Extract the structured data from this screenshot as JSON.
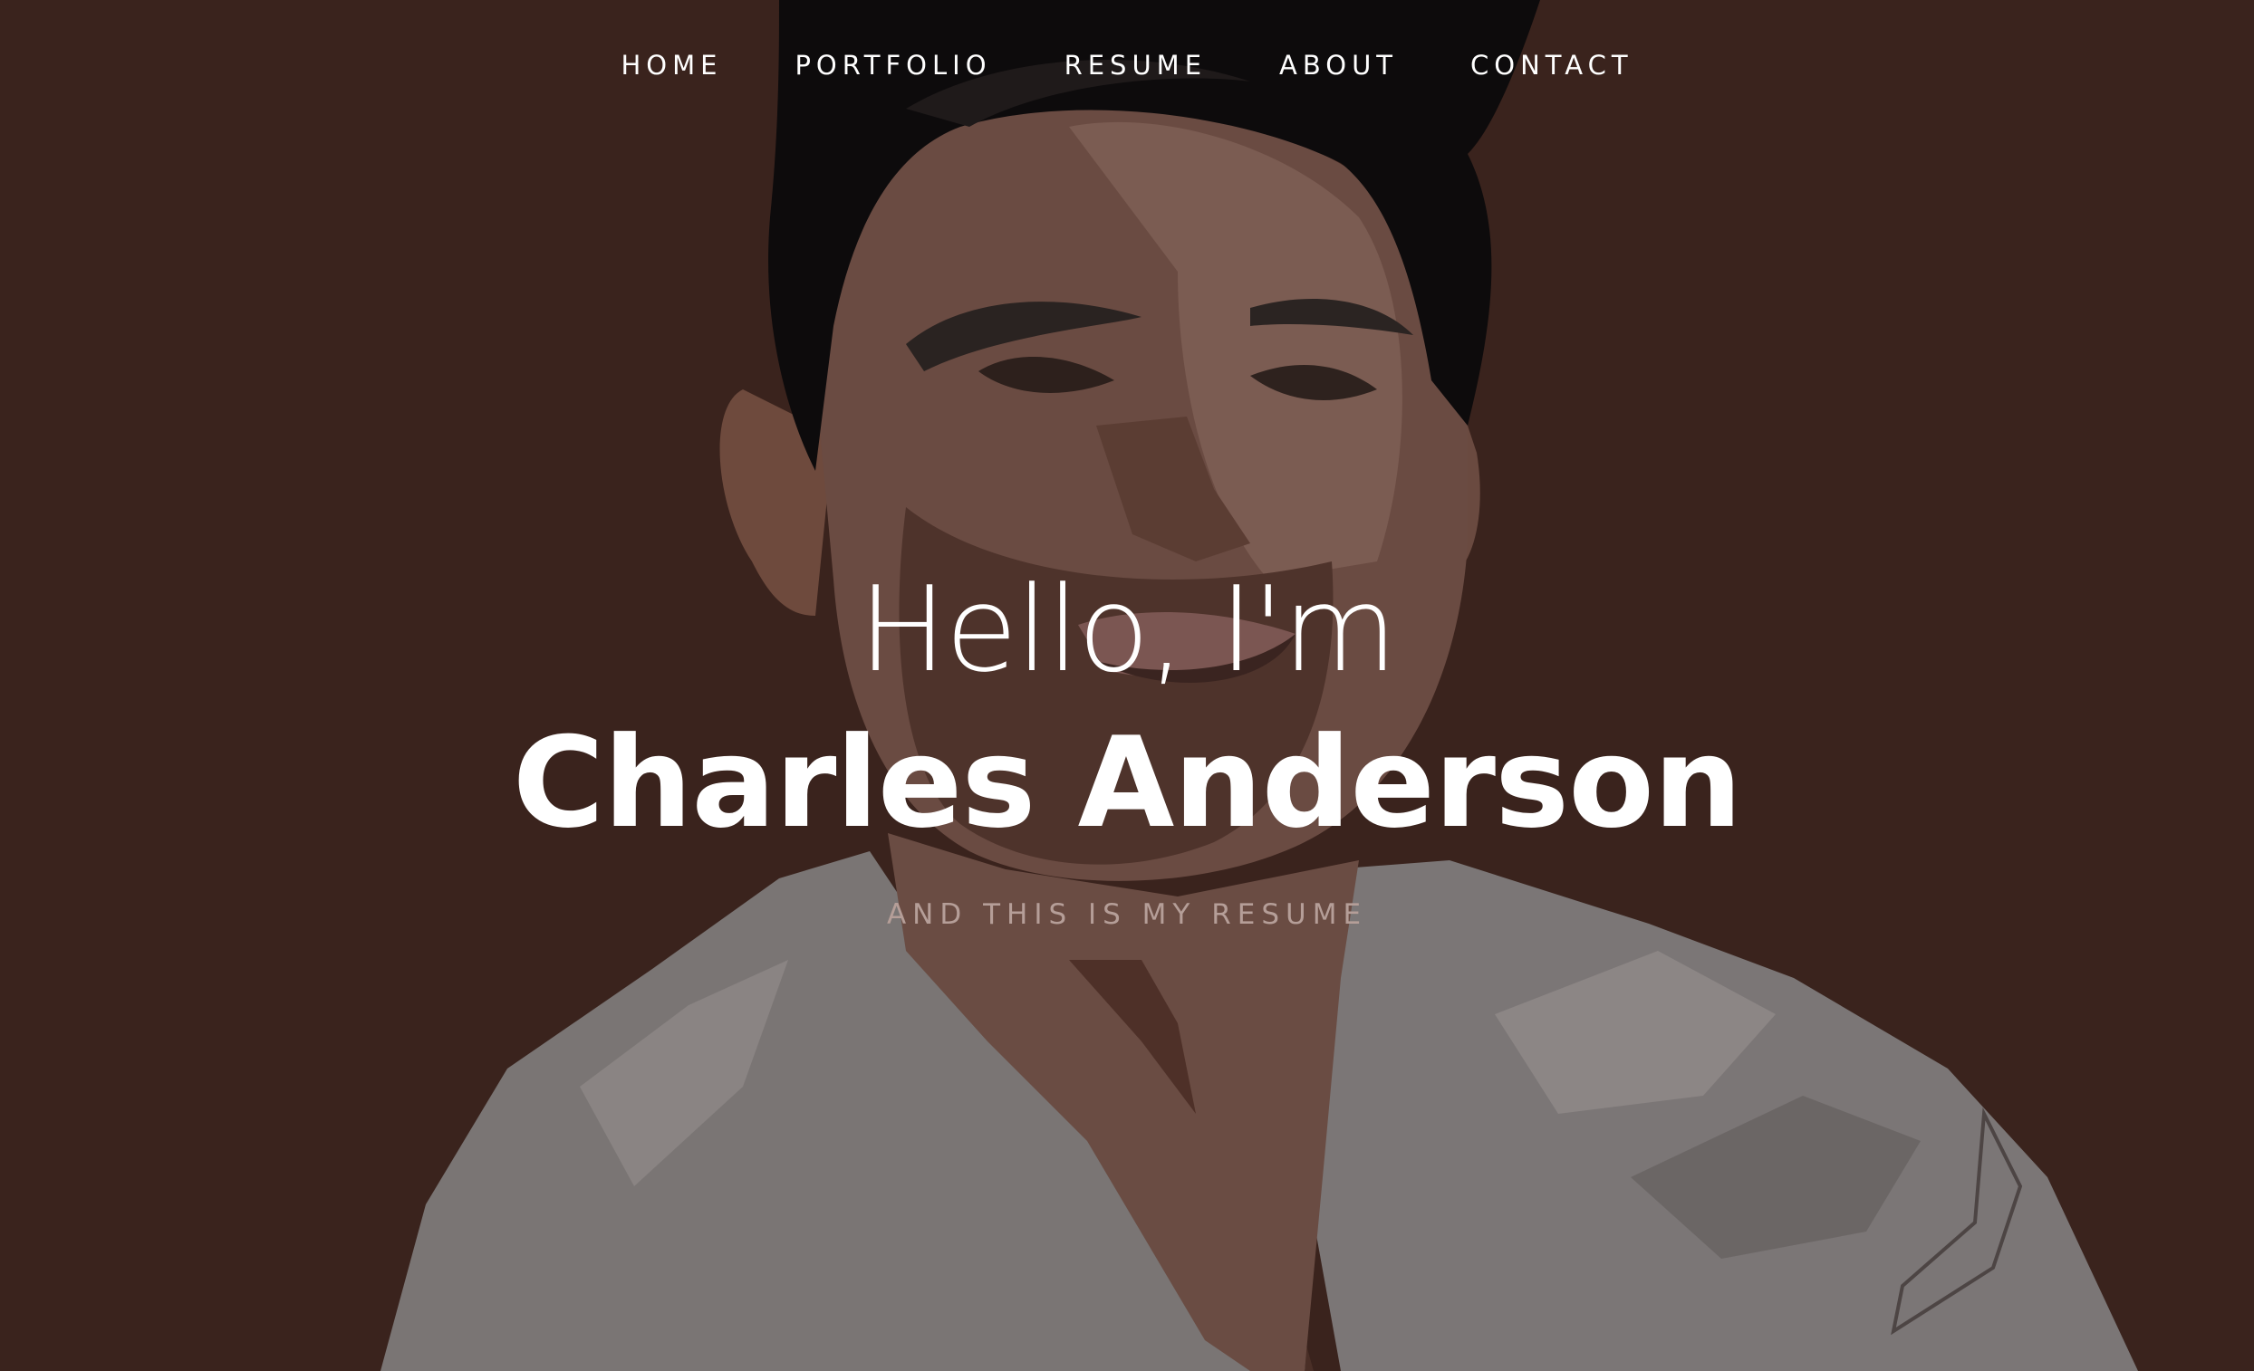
{
  "nav": {
    "items": [
      {
        "label": "HOME"
      },
      {
        "label": "PORTFOLIO"
      },
      {
        "label": "RESUME"
      },
      {
        "label": "ABOUT"
      },
      {
        "label": "CONTACT"
      }
    ]
  },
  "hero": {
    "greeting": "Hello, I'm",
    "name": "Charles Anderson",
    "tagline": "AND THIS IS MY RESUME"
  },
  "colors": {
    "background": "#3a231d",
    "text": "#ffffff",
    "tagline": "#b59e98"
  }
}
